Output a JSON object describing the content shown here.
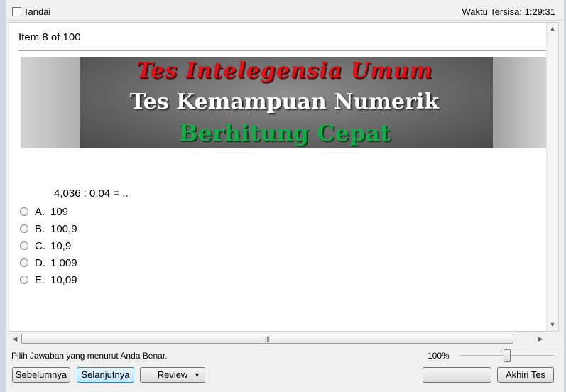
{
  "header": {
    "flag_label": "Tandai",
    "timer_label": "Waktu Tersisa:",
    "timer_value": "1:29:31"
  },
  "item": {
    "counter": "Item 8 of 100"
  },
  "banner": {
    "line1": "Tes Intelegensia Umum",
    "line2": "Tes Kemampuan Numerik",
    "line3": "Berhitung Cepat"
  },
  "question": {
    "text": "4,036 : 0,04 = .."
  },
  "options": [
    {
      "letter": "A.",
      "value": "109"
    },
    {
      "letter": "B.",
      "value": "100,9"
    },
    {
      "letter": "C.",
      "value": "10,9"
    },
    {
      "letter": "D.",
      "value": "1,009"
    },
    {
      "letter": "E.",
      "value": "10,09"
    }
  ],
  "status": {
    "hint": "Pilih Jawaban yang menurut Anda Benar.",
    "zoom": "100%"
  },
  "buttons": {
    "prev": "Sebelumnya",
    "next": "Selanjutnya",
    "review": "Review",
    "blank": "",
    "end": "Akhiri Tes"
  },
  "icons": {
    "checkbox": "checkbox-icon",
    "scroll_up": "scroll-up-icon",
    "scroll_down": "scroll-down-icon",
    "scroll_left": "scroll-left-icon",
    "scroll_right": "scroll-right-icon",
    "dropdown": "chevron-down-icon"
  }
}
